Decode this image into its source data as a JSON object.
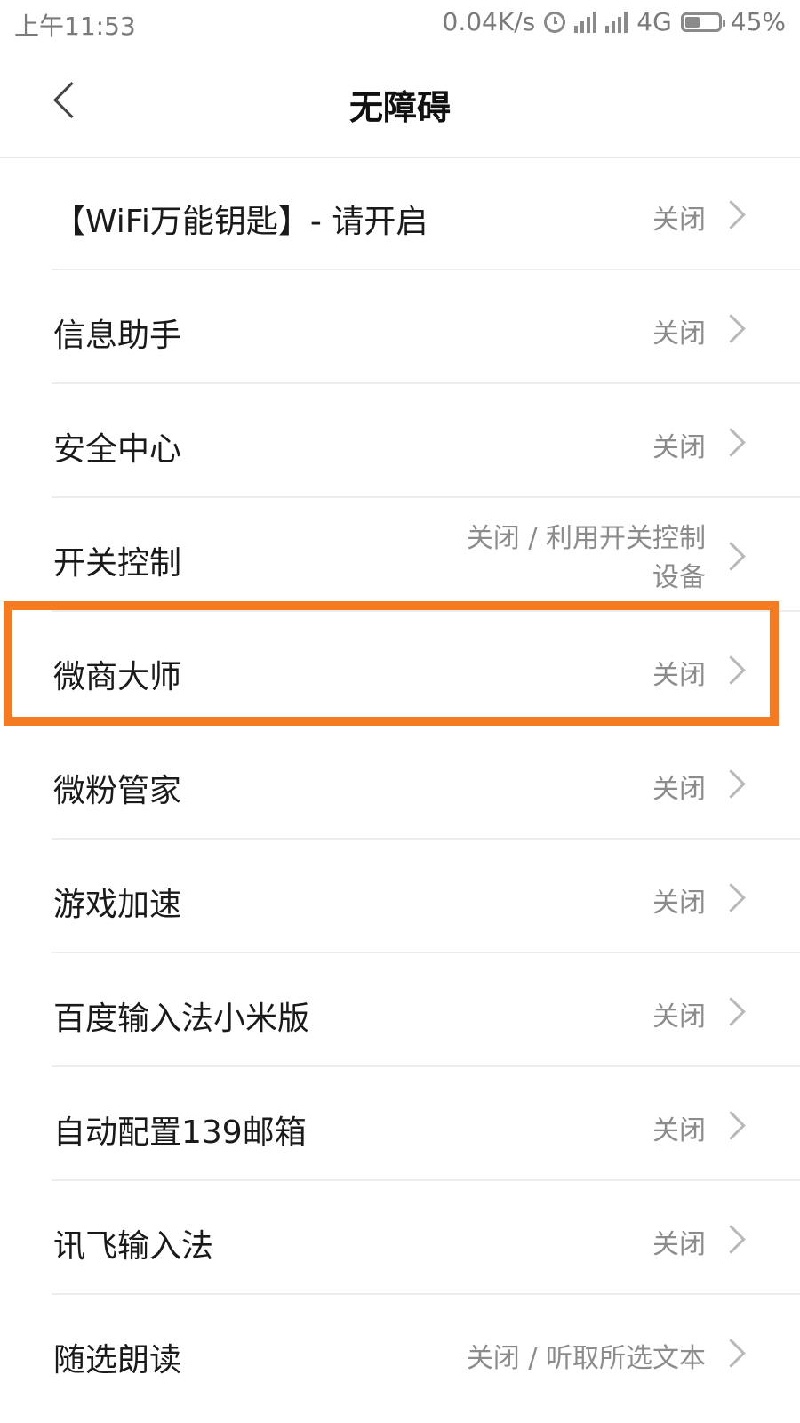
{
  "status_bar": {
    "time": "上午11:53",
    "speed": "0.04K/s",
    "network": "4G",
    "battery_text": "45%",
    "battery_level": 0.45,
    "alarm_icon": "alarm-clock-icon",
    "signal_icon": "signal-icon"
  },
  "header": {
    "title": "无障碍",
    "back_icon": "back-arrow-icon"
  },
  "list": {
    "items": [
      {
        "label": "【WiFi万能钥匙】- 请开启",
        "value": "关闭"
      },
      {
        "label": "信息助手",
        "value": "关闭"
      },
      {
        "label": "安全中心",
        "value": "关闭"
      },
      {
        "label": "开关控制",
        "value": "关闭 / 利用开关控制设备"
      },
      {
        "label": "微商大师",
        "value": "关闭"
      },
      {
        "label": "微粉管家",
        "value": "关闭"
      },
      {
        "label": "游戏加速",
        "value": "关闭"
      },
      {
        "label": "百度输入法小米版",
        "value": "关闭"
      },
      {
        "label": "自动配置139邮箱",
        "value": "关闭"
      },
      {
        "label": "讯飞输入法",
        "value": "关闭"
      },
      {
        "label": "随选朗读",
        "value": "关闭 / 听取所选文本"
      }
    ],
    "highlight_color": "#f47b20"
  }
}
